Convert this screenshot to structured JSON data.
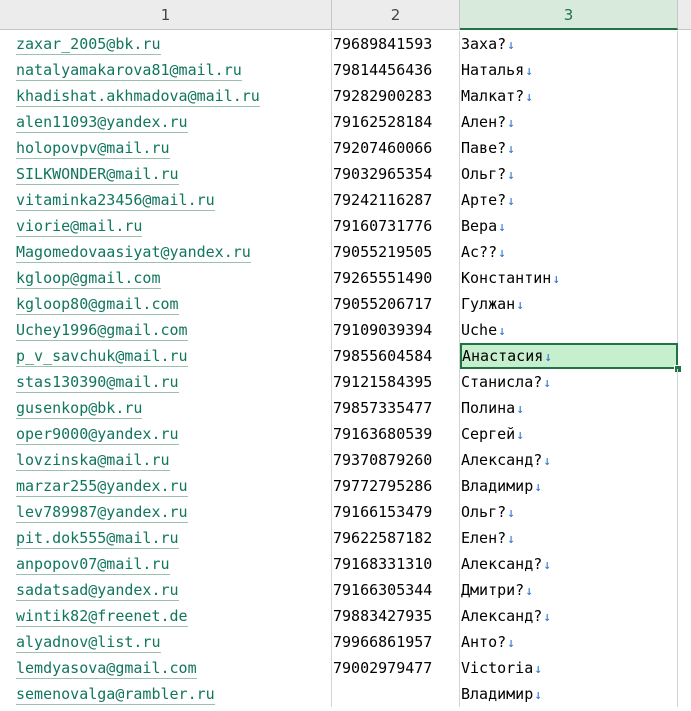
{
  "columns": [
    "1",
    "2",
    "3"
  ],
  "active_column": 2,
  "selected_row": 12,
  "newline_icon": "down-arrow-icon",
  "arrow_glyph": "↓",
  "rows": [
    {
      "email": "zaxar_2005@bk.ru",
      "phone": "79689841593",
      "name": "Заха?",
      "arrow": true
    },
    {
      "email": "natalyamakarova81@mail.ru",
      "phone": "79814456436",
      "name": "Наталья",
      "arrow": true
    },
    {
      "email": "khadishat.akhmadova@mail.ru",
      "phone": "79282900283",
      "name": "Малкат?",
      "arrow": true
    },
    {
      "email": "alen11093@yandex.ru",
      "phone": "79162528184",
      "name": "Ален?",
      "arrow": true
    },
    {
      "email": "holopovpv@mail.ru",
      "phone": "79207460066",
      "name": "Паве?",
      "arrow": true
    },
    {
      "email": "SILKWONDER@mail.ru",
      "phone": "79032965354",
      "name": "Ольг?",
      "arrow": true
    },
    {
      "email": "vitaminka23456@mail.ru",
      "phone": "79242116287",
      "name": "Арте?",
      "arrow": true
    },
    {
      "email": "viorie@mail.ru",
      "phone": "79160731776",
      "name": "Вера",
      "arrow": true
    },
    {
      "email": "Magomedovaasiyat@yandex.ru",
      "phone": "79055219505",
      "name": "Ас??",
      "arrow": true
    },
    {
      "email": "kgloop@gmail.com",
      "phone": "79265551490",
      "name": "Константин",
      "arrow": true
    },
    {
      "email": "kgloop80@gmail.com",
      "phone": "79055206717",
      "name": "Гулжан",
      "arrow": true
    },
    {
      "email": "Uchey1996@gmail.com",
      "phone": "79109039394",
      "name": "Uche",
      "arrow": true
    },
    {
      "email": "p_v_savchuk@mail.ru",
      "phone": "79855604584",
      "name": "Анастасия",
      "arrow": true
    },
    {
      "email": "stas130390@mail.ru",
      "phone": "79121584395",
      "name": "Станисла?",
      "arrow": true
    },
    {
      "email": "gusenkop@bk.ru",
      "phone": "79857335477",
      "name": "Полина",
      "arrow": true
    },
    {
      "email": "oper9000@yandex.ru",
      "phone": "79163680539",
      "name": "Сергей",
      "arrow": true
    },
    {
      "email": "lovzinska@mail.ru",
      "phone": "79370879260",
      "name": "Александ?",
      "arrow": true
    },
    {
      "email": "marzar255@yandex.ru",
      "phone": "79772795286",
      "name": "Владимир",
      "arrow": true
    },
    {
      "email": "lev789987@yandex.ru",
      "phone": "79166153479",
      "name": "Ольг?",
      "arrow": true
    },
    {
      "email": "pit.dok555@mail.ru",
      "phone": "79622587182",
      "name": "Елен?",
      "arrow": true
    },
    {
      "email": "anpopov07@mail.ru",
      "phone": "79168331310",
      "name": "Александ?",
      "arrow": true
    },
    {
      "email": "sadatsad@yandex.ru",
      "phone": "79166305344",
      "name": "Дмитри?",
      "arrow": true
    },
    {
      "email": "wintik82@freenet.de",
      "phone": "79883427935",
      "name": "Александ?",
      "arrow": true
    },
    {
      "email": "alyadnov@list.ru",
      "phone": "79966861957",
      "name": "Анто?",
      "arrow": true
    },
    {
      "email": "lemdyasova@gmail.com",
      "phone": "79002979477",
      "name": "Victoria",
      "arrow": true
    },
    {
      "email": "semenovalga@rambler.ru",
      "phone": "",
      "name": "Владимир",
      "arrow": true
    }
  ]
}
